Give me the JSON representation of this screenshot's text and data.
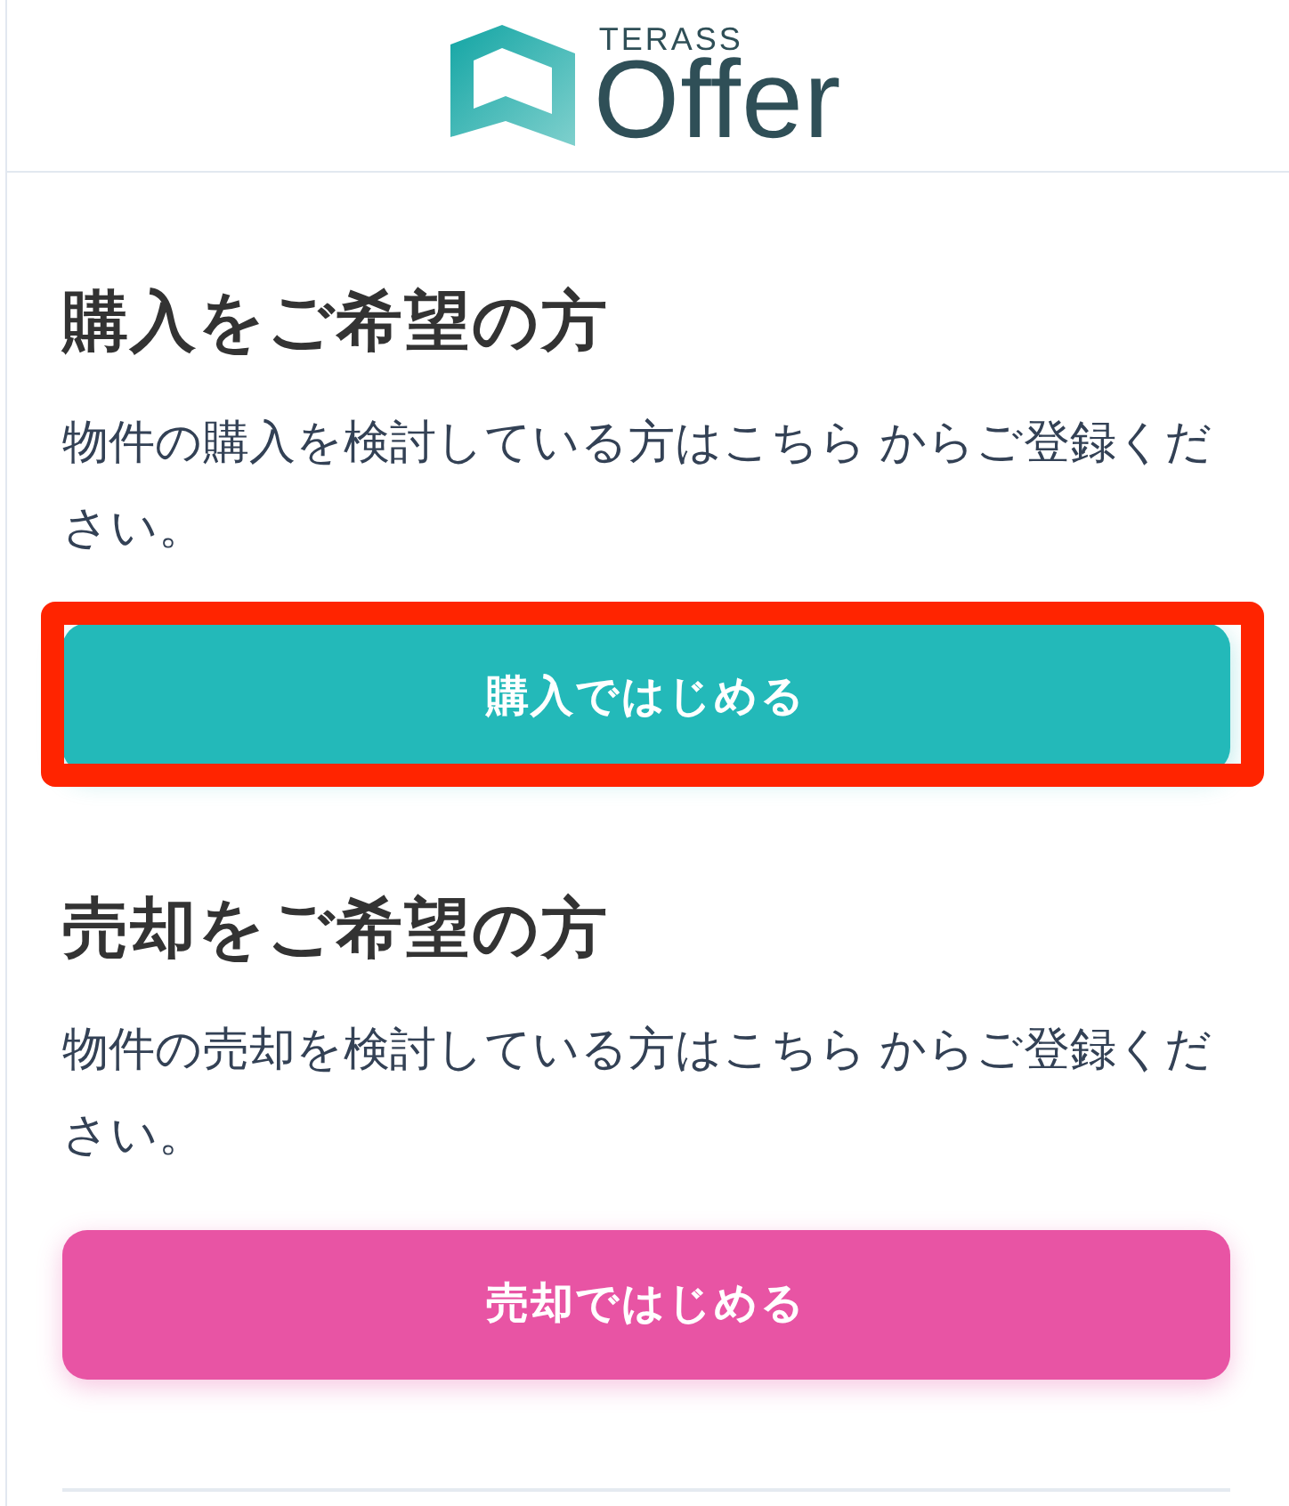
{
  "header": {
    "logo": {
      "brand": "TERASS",
      "product": "Offer"
    }
  },
  "sections": [
    {
      "title": "購入をご希望の方",
      "description": "物件の購入を検討している方はこちら からご登録ください。",
      "button": {
        "label": "購入ではじめる",
        "color": "#23b9b9"
      },
      "highlighted": true
    },
    {
      "title": "売却をご希望の方",
      "description": "物件の売却を検討している方はこちら からご登録ください。",
      "button": {
        "label": "売却ではじめる",
        "color": "#e854a4"
      },
      "highlighted": false
    }
  ]
}
